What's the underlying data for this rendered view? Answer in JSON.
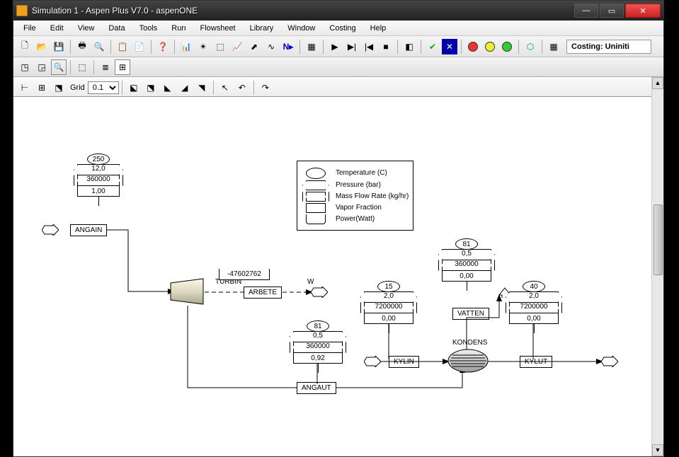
{
  "title": "Simulation 1 - Aspen Plus V7.0 - aspenONE",
  "menu": [
    "File",
    "Edit",
    "View",
    "Data",
    "Tools",
    "Run",
    "Flowsheet",
    "Library",
    "Window",
    "Costing",
    "Help"
  ],
  "costing_status": "Costing: Uniniti",
  "grid_label": "Grid",
  "grid_value": "0.1",
  "legend": {
    "temperature": "Temperature (C)",
    "pressure": "Pressure (bar)",
    "massflow": "Mass Flow Rate (kg/hr)",
    "vaporfrac": "Vapor Fraction",
    "power": "Power(Watt)"
  },
  "units": {
    "turbin_label": "TURBIN",
    "kondens_label": "KONDENS",
    "w_label": "W"
  },
  "streams": {
    "angain": {
      "name": "ANGAIN",
      "temperature": "250",
      "pressure": "12,0",
      "massflow": "360000",
      "vaporfrac": "1,00"
    },
    "arbete": {
      "name": "ARBETE",
      "power": "-47602762"
    },
    "angaut": {
      "name": "ANGAUT",
      "temperature": "81",
      "pressure": "0,5",
      "massflow": "360000",
      "vaporfrac": "0,92"
    },
    "kylin": {
      "name": "KYLIN",
      "temperature": "15",
      "pressure": "2,0",
      "massflow": "7200000",
      "vaporfrac": "0,00"
    },
    "vatten": {
      "name": "VATTEN",
      "temperature": "81",
      "pressure": "0,5",
      "massflow": "360000",
      "vaporfrac": "0,00"
    },
    "kylut": {
      "name": "KYLUT",
      "temperature": "40",
      "pressure": "2,0",
      "massflow": "7200000",
      "vaporfrac": "0,00"
    }
  }
}
